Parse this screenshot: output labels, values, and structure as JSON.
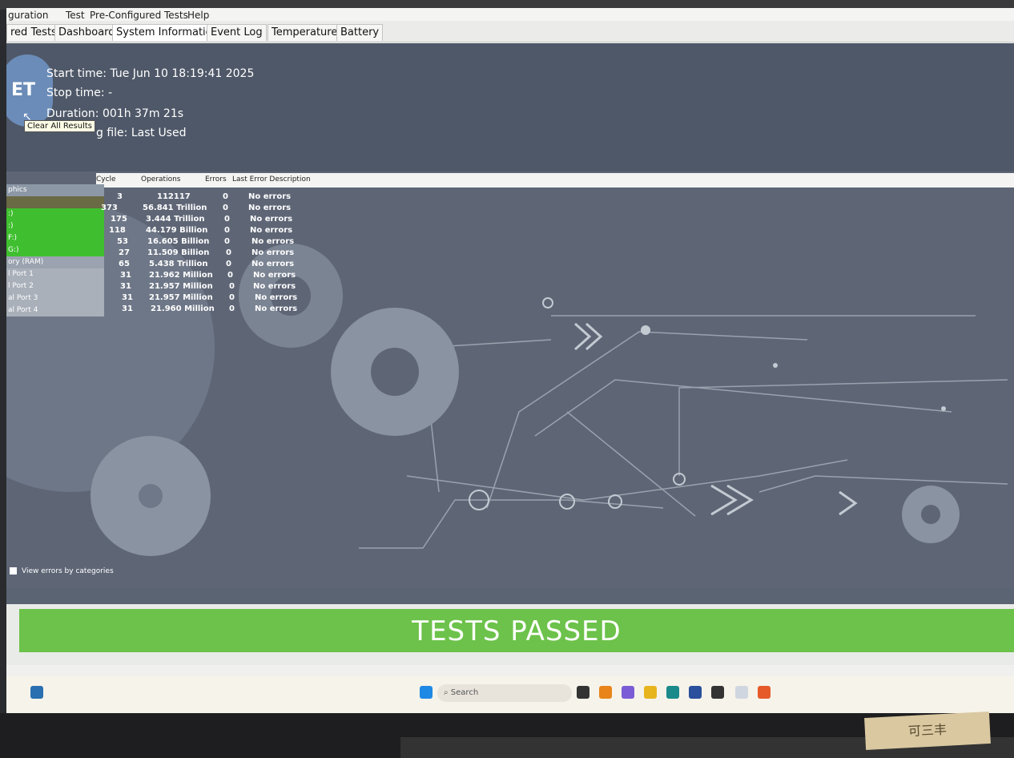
{
  "menu": [
    "guration",
    "Test",
    "Pre-Configured Tests",
    "Help"
  ],
  "tabs": [
    "red Tests",
    "Dashboard",
    "System Information",
    "Event Log",
    "Temperature",
    "Battery"
  ],
  "logo_text": "ET",
  "start_time": "Start time: Tue Jun 10 18:19:41 2025",
  "stop_time": "Stop time: -",
  "duration": "Duration: 001h 37m 21s",
  "config_file": "g file: Last Used",
  "tooltip": "Clear All Results",
  "table": {
    "headers": [
      "Cycle",
      "Operations",
      "Errors",
      "Last Error Description"
    ],
    "left_labels": [
      "phics",
      "",
      ":)",
      ":)",
      "F:)",
      "G:)",
      "ory (RAM)",
      "l Port 1",
      "l Port 2",
      "al Port 3",
      "al Port 4"
    ],
    "rows": [
      {
        "cycle": "3",
        "ops": "112117",
        "errors": "0",
        "desc": "No errors"
      },
      {
        "cycle": "373",
        "ops": "56.841 Trillion",
        "errors": "0",
        "desc": "No errors"
      },
      {
        "cycle": "175",
        "ops": "3.444 Trillion",
        "errors": "0",
        "desc": "No errors"
      },
      {
        "cycle": "118",
        "ops": "44.179 Billion",
        "errors": "0",
        "desc": "No errors"
      },
      {
        "cycle": "53",
        "ops": "16.605 Billion",
        "errors": "0",
        "desc": "No errors"
      },
      {
        "cycle": "27",
        "ops": "11.509 Billion",
        "errors": "0",
        "desc": "No errors"
      },
      {
        "cycle": "65",
        "ops": "5.438 Trillion",
        "errors": "0",
        "desc": "No errors"
      },
      {
        "cycle": "31",
        "ops": "21.962 Million",
        "errors": "0",
        "desc": "No errors"
      },
      {
        "cycle": "31",
        "ops": "21.957 Million",
        "errors": "0",
        "desc": "No errors"
      },
      {
        "cycle": "31",
        "ops": "21.957 Million",
        "errors": "0",
        "desc": "No errors"
      },
      {
        "cycle": "31",
        "ops": "21.960 Million",
        "errors": "0",
        "desc": "No errors"
      }
    ]
  },
  "view_errors": "View errors by categories",
  "status": "TESTS PASSED",
  "taskbar_search": "Search",
  "sticker": "可三丰",
  "colors": {
    "passed": "#6cc24a",
    "panel": "#5b6473",
    "green_rows": "#3fbf2f"
  }
}
